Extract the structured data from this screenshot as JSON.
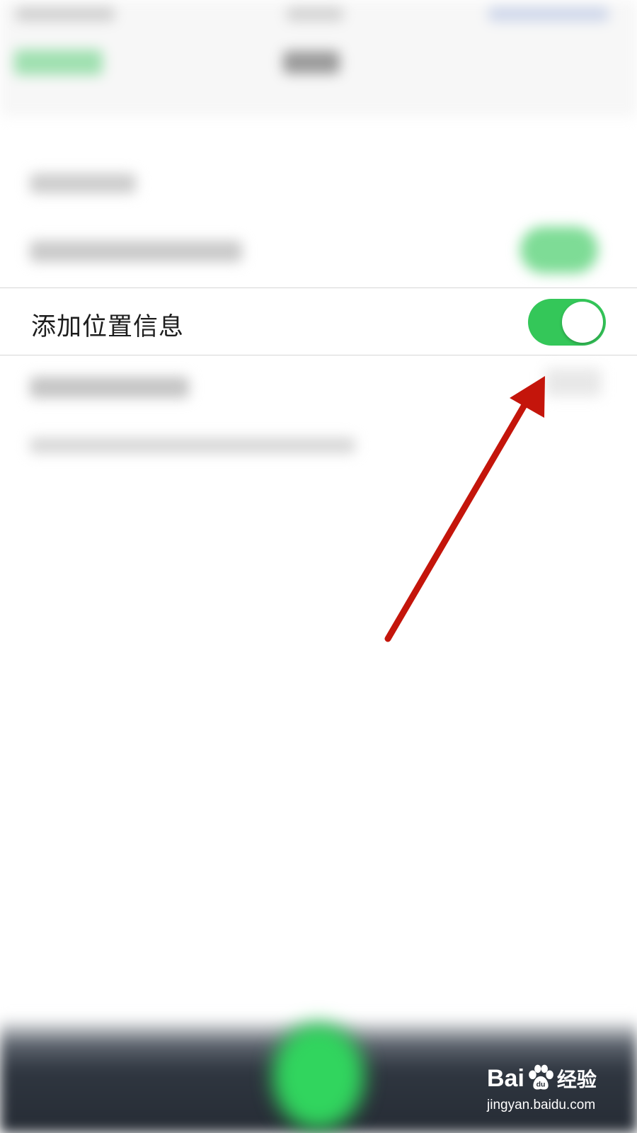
{
  "setting": {
    "label": "添加位置信息",
    "enabled": true,
    "toggle_color": "#34c759"
  },
  "annotation": {
    "arrow_color": "#c4150b",
    "icon": "arrow-pointer-icon"
  },
  "watermark": {
    "brand_left": "Bai",
    "brand_right": "经验",
    "url": "jingyan.baidu.com",
    "icon": "baidu-paw-icon"
  }
}
